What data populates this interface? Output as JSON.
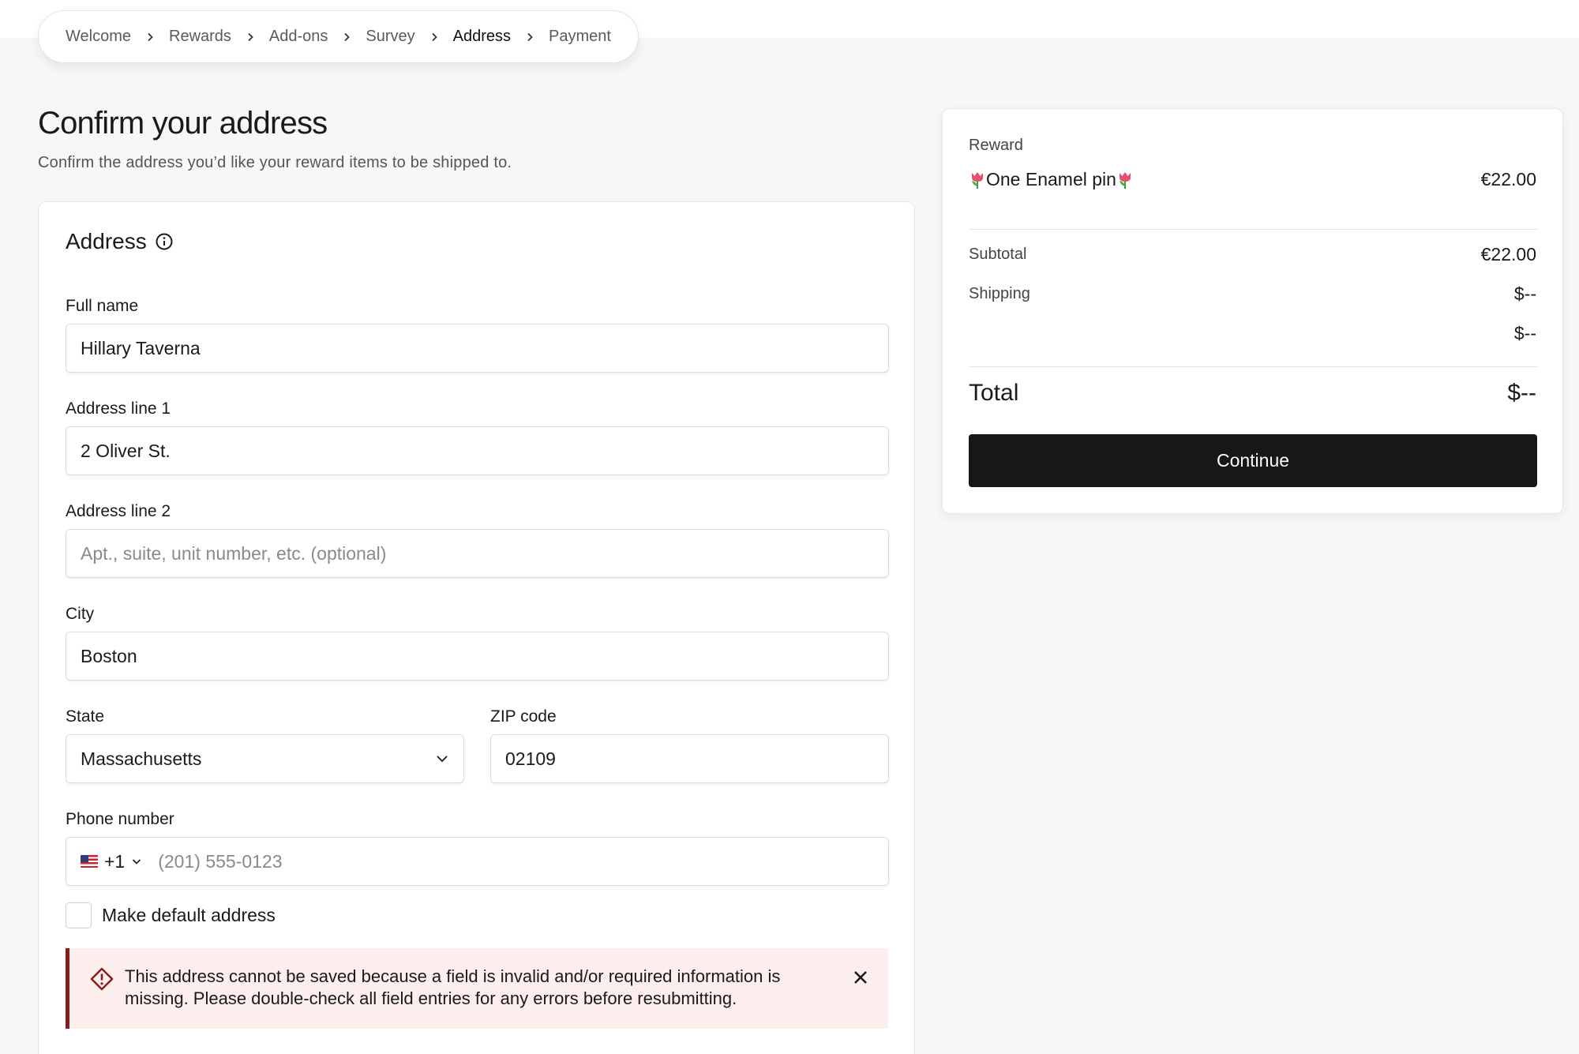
{
  "breadcrumb": {
    "items": [
      {
        "label": "Welcome"
      },
      {
        "label": "Rewards"
      },
      {
        "label": "Add-ons"
      },
      {
        "label": "Survey"
      },
      {
        "label": "Address",
        "active": true
      },
      {
        "label": "Payment"
      }
    ]
  },
  "page": {
    "title": "Confirm your address",
    "subtitle": "Confirm the address you’d like your reward items to be shipped to."
  },
  "address_form": {
    "heading": "Address",
    "full_name": {
      "label": "Full name",
      "value": "Hillary Taverna"
    },
    "address_line_1": {
      "label": "Address line 1",
      "value": "2 Oliver St."
    },
    "address_line_2": {
      "label": "Address line 2",
      "value": "",
      "placeholder": "Apt., suite, unit number, etc. (optional)"
    },
    "city": {
      "label": "City",
      "value": "Boston"
    },
    "state": {
      "label": "State",
      "value": "Massachusetts"
    },
    "zip": {
      "label": "ZIP code",
      "value": "02109"
    },
    "phone": {
      "label": "Phone number",
      "country_code": "+1",
      "country_flag": "us-flag-icon",
      "value": "",
      "placeholder": "(201) 555-0123"
    },
    "default_address": {
      "label": "Make default address",
      "checked": false
    },
    "error": {
      "message": "This address cannot be saved because a field is invalid and/or required information is missing. Please double-check all field entries for any errors before resubmitting.",
      "color": "#8b1a1a",
      "background": "#fbeeec"
    }
  },
  "summary": {
    "reward_label": "Reward",
    "reward_name": "One Enamel pin",
    "reward_price": "€22.00",
    "subtotal_label": "Subtotal",
    "subtotal_value": "€22.00",
    "shipping_label": "Shipping",
    "shipping_value": "$--",
    "extra_value": "$--",
    "total_label": "Total",
    "total_value": "$--",
    "continue_label": "Continue",
    "button_color": "#171717"
  }
}
